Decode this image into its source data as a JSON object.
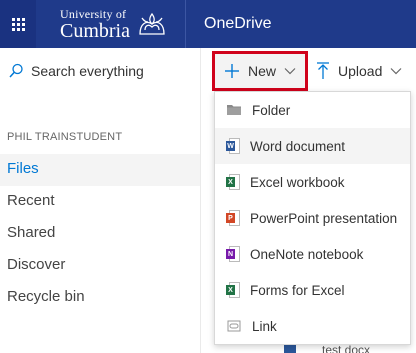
{
  "header": {
    "university_line1": "University of",
    "university_line2": "Cumbria",
    "app_name": "OneDrive"
  },
  "sidebar": {
    "search_label": "Search everything",
    "owner": "PHIL TRAINSTUDENT",
    "items": [
      {
        "label": "Files",
        "active": true
      },
      {
        "label": "Recent"
      },
      {
        "label": "Shared"
      },
      {
        "label": "Discover"
      },
      {
        "label": "Recycle bin"
      }
    ]
  },
  "toolbar": {
    "new_label": "New",
    "upload_label": "Upload"
  },
  "new_menu": {
    "items": [
      {
        "label": "Folder",
        "icon": "folder-icon"
      },
      {
        "label": "Word document",
        "icon": "word-icon",
        "color": "#2b579a"
      },
      {
        "label": "Excel workbook",
        "icon": "excel-icon",
        "color": "#217346"
      },
      {
        "label": "PowerPoint presentation",
        "icon": "powerpoint-icon",
        "color": "#d24726"
      },
      {
        "label": "OneNote notebook",
        "icon": "onenote-icon",
        "color": "#7719aa"
      },
      {
        "label": "Forms for Excel",
        "icon": "forms-icon",
        "color": "#217346"
      },
      {
        "label": "Link",
        "icon": "link-icon"
      }
    ]
  },
  "file_list": {
    "partial_file_name": "test docx"
  },
  "colors": {
    "suite_bar": "#1f3a8a",
    "accent": "#0078d4",
    "highlight_border": "#d0021b"
  }
}
